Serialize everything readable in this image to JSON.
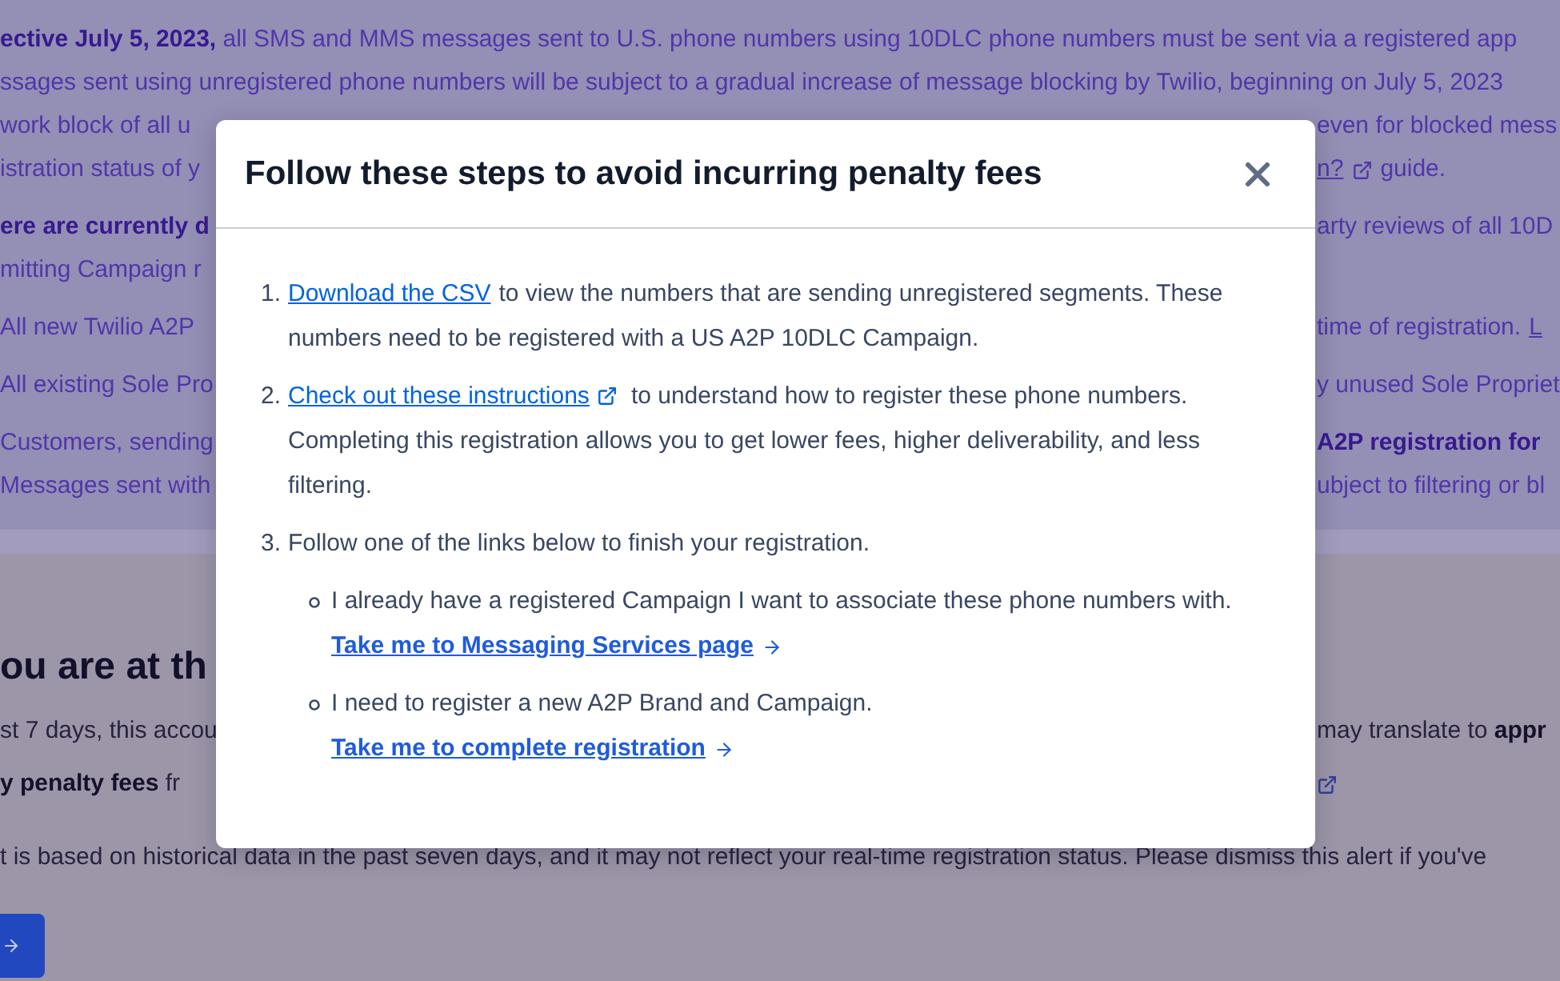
{
  "alert": {
    "blocks": [
      [
        {
          "left": [
            {
              "kind": "text",
              "text": "**ective July 5, 2023,** all SMS and MMS messages sent to U.S. phone numbers using 10DLC phone numbers must be sent via a registered app"
            }
          ]
        },
        {
          "left": [
            {
              "kind": "text",
              "text": "ssages sent using unregistered phone numbers will be subject to a gradual increase of message blocking by Twilio, beginning on July 5, 2023"
            }
          ]
        },
        {
          "left": [
            {
              "kind": "text",
              "text": "work block of all u"
            }
          ],
          "right": [
            {
              "kind": "text",
              "text": "even for blocked mess"
            }
          ]
        },
        {
          "left": [
            {
              "kind": "text",
              "text": "istration status of y"
            }
          ],
          "right": [
            {
              "kind": "link",
              "text": "n?"
            },
            {
              "kind": "external_icon"
            },
            {
              "kind": "text",
              "text": "guide."
            }
          ]
        }
      ],
      [
        {
          "left": [
            {
              "kind": "bold",
              "text": "ere are currently d"
            }
          ],
          "right": [
            {
              "kind": "text",
              "text": "arty reviews of all 10D"
            }
          ]
        },
        {
          "left": [
            {
              "kind": "text",
              "text": "mitting Campaign r"
            }
          ]
        }
      ],
      [
        {
          "left": [
            {
              "kind": "text",
              "text": "All new Twilio A2P"
            }
          ],
          "right": [
            {
              "kind": "text",
              "text": "time of registration."
            },
            {
              "kind": "link",
              "text": "L"
            }
          ]
        }
      ],
      [
        {
          "left": [
            {
              "kind": "text",
              "text": "All existing Sole Pro"
            }
          ],
          "right": [
            {
              "kind": "text",
              "text": "y unused Sole Propriet"
            }
          ]
        }
      ],
      [
        {
          "left": [
            {
              "kind": "text",
              "text": "Customers, sending"
            }
          ],
          "right": [
            {
              "kind": "bold",
              "text": "A2P registration for"
            }
          ]
        },
        {
          "left": [
            {
              "kind": "text",
              "text": "Messages sent with"
            }
          ],
          "right": [
            {
              "kind": "text",
              "text": "ubject to filtering or bl"
            }
          ]
        }
      ]
    ]
  },
  "section": {
    "heading": "ou are at th",
    "lines": [
      {
        "left": [
          {
            "kind": "text",
            "text": "st 7 days, this accou"
          }
        ],
        "right": [
          {
            "kind": "text",
            "text": "may translate to **appr**"
          }
        ]
      },
      {
        "left": [
          {
            "kind": "text",
            "text": "**y penalty fees** fr"
          }
        ],
        "right": [
          {
            "kind": "external_icon"
          }
        ]
      }
    ],
    "note": "t is based on historical data in the past seven days, and it may not reflect your real-time registration status. Please dismiss this alert if you've"
  },
  "modal": {
    "title": "Follow these steps to avoid incurring penalty fees",
    "steps": [
      {
        "number": "1.",
        "link": "Download the CSV",
        "external": false,
        "text": "to view the numbers that are sending unregistered segments. These numbers need to be registered with a US A2P 10DLC Campaign."
      },
      {
        "number": "2.",
        "link": "Check out these instructions",
        "external": true,
        "text": "to understand how to register these phone numbers. Completing this registration allows you to get lower fees, higher deliverability, and less filtering."
      },
      {
        "number": "3.",
        "text": "Follow one of the links below to finish your registration.",
        "options": [
          {
            "text": "I already have a registered Campaign I want to associate these phone numbers with.",
            "link": "Take me to Messaging Services page"
          },
          {
            "text": "I need to register a new A2P Brand and Campaign.",
            "link": "Take me to complete registration"
          }
        ]
      }
    ]
  }
}
